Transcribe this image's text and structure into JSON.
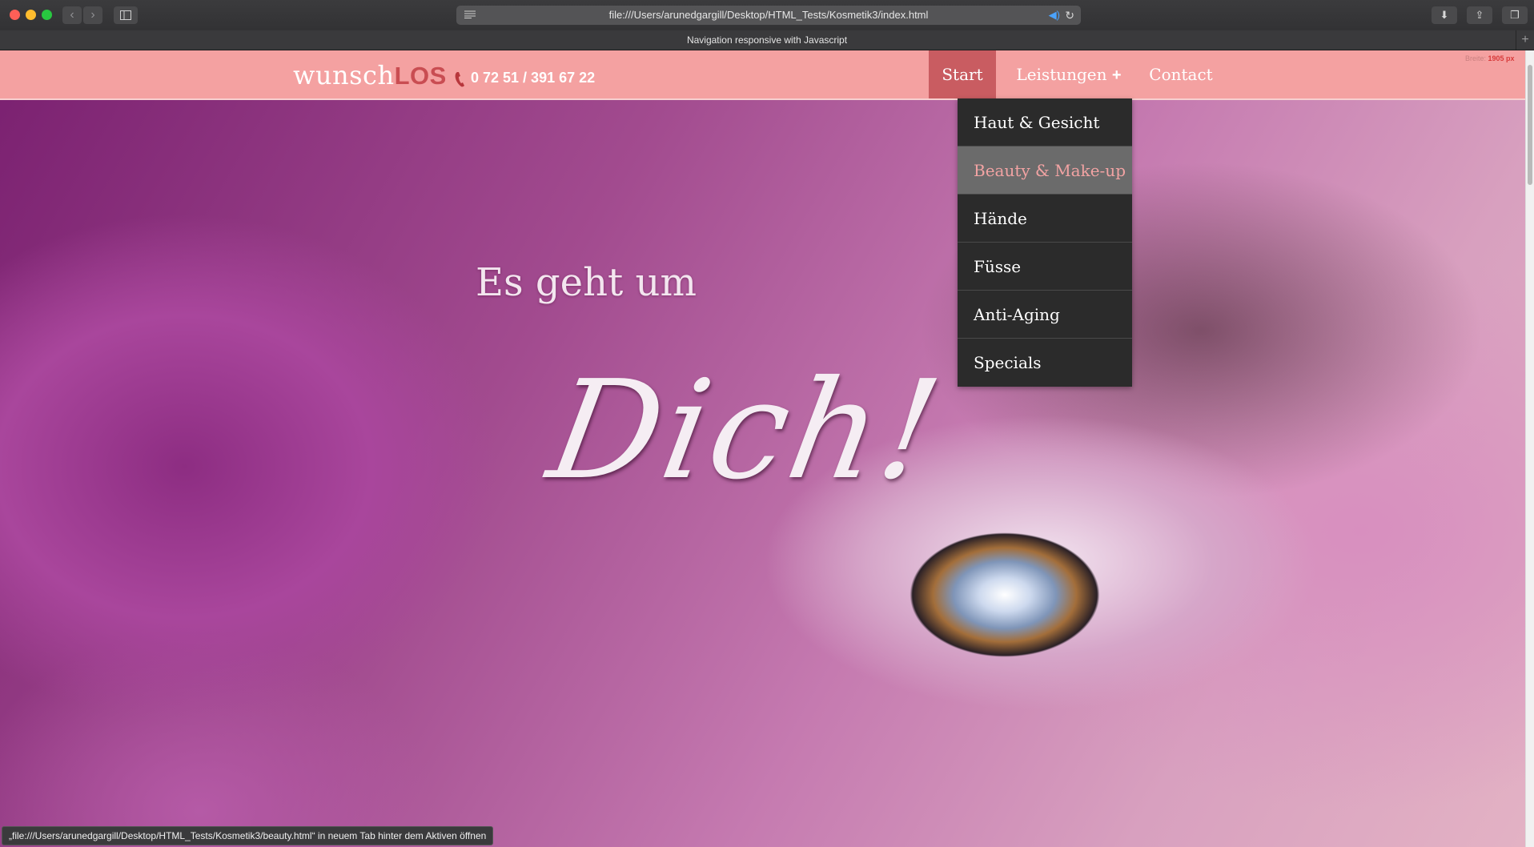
{
  "browser": {
    "url": "file:///Users/arunedgargill/Desktop/HTML_Tests/Kosmetik3/index.html",
    "tab_title": "Navigation responsive with Javascript",
    "status_text": "„file:///Users/arunedgargill/Desktop/HTML_Tests/Kosmetik3/beauty.html“ in neuem Tab hinter dem Aktiven öffnen"
  },
  "site": {
    "logo_light": "wunsch",
    "logo_strong": "LOS",
    "phone": "0 72 51 / 391 67 22",
    "width_label": "Breite:",
    "width_value": "1905 px",
    "colors": {
      "nav_bg": "#f4a1a1",
      "active_bg": "#c95c61",
      "logo_accent": "#c94d52",
      "dropdown_bg": "#2b2b2b",
      "dropdown_hover_text": "#f2a3a3"
    }
  },
  "nav": {
    "start": "Start",
    "leistungen": "Leistungen",
    "leistungen_plus": "+",
    "contact": "Contact"
  },
  "dropdown": {
    "items": [
      "Haut & Gesicht",
      "Beauty & Make-up",
      "Hände",
      "Füsse",
      "Anti-Aging",
      "Specials"
    ],
    "hovered_index": 1
  },
  "hero": {
    "line1": "Es geht um",
    "line2": "Dich!"
  },
  "icons": {
    "phone": "phone-icon",
    "reader": "reader-icon",
    "audio": "audio-icon",
    "reload": "reload-icon"
  }
}
